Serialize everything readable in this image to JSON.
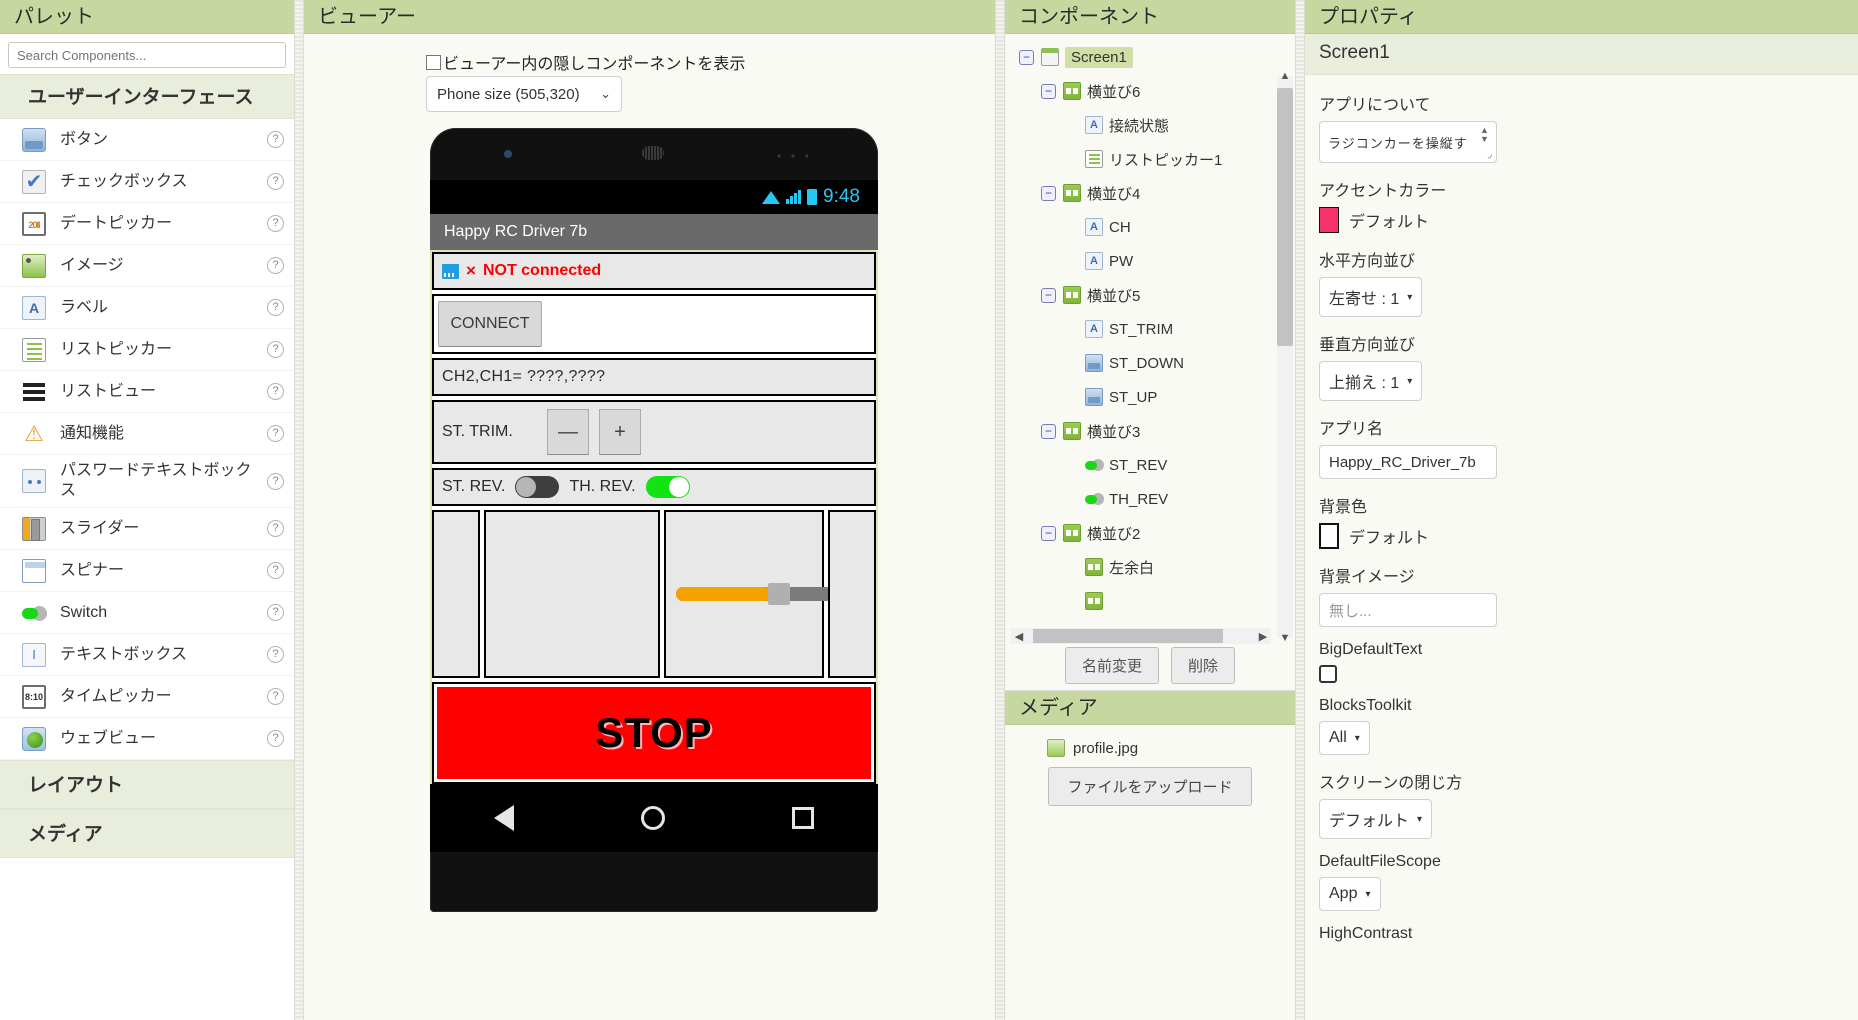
{
  "palette": {
    "title": "パレット",
    "search_placeholder": "Search Components...",
    "categories": [
      {
        "name": "ユーザーインターフェース"
      },
      {
        "name": "レイアウト"
      },
      {
        "name": "メディア"
      }
    ],
    "items": [
      {
        "label": "ボタン",
        "icon": "button-icon",
        "help": "?"
      },
      {
        "label": "チェックボックス",
        "icon": "checkbox-icon",
        "help": "?"
      },
      {
        "label": "デートピッカー",
        "icon": "datepicker-icon",
        "help": "?"
      },
      {
        "label": "イメージ",
        "icon": "image-icon",
        "help": "?"
      },
      {
        "label": "ラベル",
        "icon": "label-icon",
        "help": "?"
      },
      {
        "label": "リストピッカー",
        "icon": "listpicker-icon",
        "help": "?"
      },
      {
        "label": "リストビュー",
        "icon": "listview-icon",
        "help": "?"
      },
      {
        "label": "通知機能",
        "icon": "notifier-icon",
        "help": "?"
      },
      {
        "label": "パスワードテキストボックス",
        "icon": "password-icon",
        "help": "?"
      },
      {
        "label": "スライダー",
        "icon": "slider-icon",
        "help": "?"
      },
      {
        "label": "スピナー",
        "icon": "spinner-icon",
        "help": "?"
      },
      {
        "label": "Switch",
        "icon": "switch-icon",
        "help": "?"
      },
      {
        "label": "テキストボックス",
        "icon": "textbox-icon",
        "help": "?"
      },
      {
        "label": "タイムピッカー",
        "icon": "timepicker-icon",
        "help": "?"
      },
      {
        "label": "ウェブビュー",
        "icon": "webview-icon",
        "help": "?"
      }
    ]
  },
  "viewer": {
    "title": "ビューアー",
    "show_hidden_label": "ビューアー内の隠しコンポーネントを表示",
    "size_option": "Phone size (505,320)",
    "phone": {
      "status_time": "9:48",
      "app_bar_title": "Happy RC Driver 7b",
      "connection_status": "NOT connected",
      "connection_x": "×",
      "connect_button": "CONNECT",
      "channel_readout": "CH2,CH1=   ????,????",
      "trim_label": "ST. TRIM.",
      "trim_minus": "—",
      "trim_plus": "+",
      "st_rev_label": "ST. REV.",
      "st_rev_state": "off",
      "th_rev_label": "TH. REV.",
      "th_rev_state": "on",
      "stop_label": "STOP"
    }
  },
  "components": {
    "title": "コンポーネント",
    "tree": [
      {
        "label": "Screen1",
        "icon": "screen-icon",
        "indent": 0,
        "expander": "minus",
        "selected": true
      },
      {
        "label": "横並び6",
        "icon": "horizontal-arrangement-icon",
        "indent": 1,
        "expander": "minus",
        "selected": false
      },
      {
        "label": "接続状態",
        "icon": "label-icon",
        "indent": 2,
        "expander": "none",
        "selected": false
      },
      {
        "label": "リストピッカー1",
        "icon": "listpicker-icon",
        "indent": 2,
        "expander": "none",
        "selected": false
      },
      {
        "label": "横並び4",
        "icon": "horizontal-arrangement-icon",
        "indent": 1,
        "expander": "minus",
        "selected": false
      },
      {
        "label": "CH",
        "icon": "label-icon",
        "indent": 2,
        "expander": "none",
        "selected": false
      },
      {
        "label": "PW",
        "icon": "label-icon",
        "indent": 2,
        "expander": "none",
        "selected": false
      },
      {
        "label": "横並び5",
        "icon": "horizontal-arrangement-icon",
        "indent": 1,
        "expander": "minus",
        "selected": false
      },
      {
        "label": "ST_TRIM",
        "icon": "label-icon",
        "indent": 2,
        "expander": "none",
        "selected": false
      },
      {
        "label": "ST_DOWN",
        "icon": "button-icon",
        "indent": 2,
        "expander": "none",
        "selected": false
      },
      {
        "label": "ST_UP",
        "icon": "button-icon",
        "indent": 2,
        "expander": "none",
        "selected": false
      },
      {
        "label": "横並び3",
        "icon": "horizontal-arrangement-icon",
        "indent": 1,
        "expander": "minus",
        "selected": false
      },
      {
        "label": "ST_REV",
        "icon": "switch-icon",
        "indent": 2,
        "expander": "none",
        "selected": false
      },
      {
        "label": "TH_REV",
        "icon": "switch-icon",
        "indent": 2,
        "expander": "none",
        "selected": false
      },
      {
        "label": "横並び2",
        "icon": "horizontal-arrangement-icon",
        "indent": 1,
        "expander": "minus",
        "selected": false
      },
      {
        "label": "左余白",
        "icon": "horizontal-arrangement-icon",
        "indent": 2,
        "expander": "none",
        "selected": false
      }
    ],
    "rename_button": "名前変更",
    "delete_button": "削除"
  },
  "media": {
    "title": "メディア",
    "files": [
      {
        "name": "profile.jpg"
      }
    ],
    "upload_button": "ファイルをアップロード"
  },
  "properties": {
    "title": "プロパティ",
    "subject": "Screen1",
    "about_label": "アプリについて",
    "about_value": "ラジコンカーを操縦す",
    "accent_label": "アクセントカラー",
    "accent_value": "デフォルト",
    "accent_hex": "#f5336a",
    "halign_label": "水平方向並び",
    "halign_value": "左寄せ : 1",
    "valign_label": "垂直方向並び",
    "valign_value": "上揃え : 1",
    "appname_label": "アプリ名",
    "appname_value": "Happy_RC_Driver_7b",
    "bgcolor_label": "背景色",
    "bgcolor_value": "デフォルト",
    "bgimage_label": "背景イメージ",
    "bgimage_value": "無し...",
    "bigdefaulttext_label": "BigDefaultText",
    "blockstoolkit_label": "BlocksToolkit",
    "blockstoolkit_value": "All",
    "closescreen_label": "スクリーンの閉じ方",
    "closescreen_value": "デフォルト",
    "filescope_label": "DefaultFileScope",
    "filescope_value": "App",
    "highcontrast_label": "HighContrast"
  }
}
